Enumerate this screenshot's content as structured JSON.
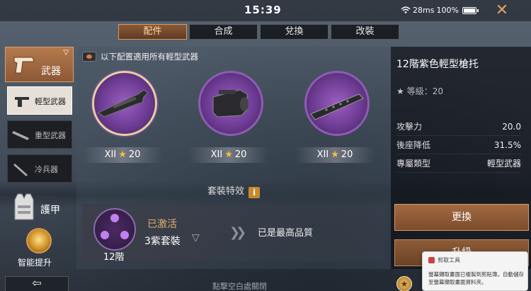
{
  "status_bar": {
    "time": "15:39",
    "latency": "28ms",
    "battery": "100%"
  },
  "tabs": [
    {
      "label": "配件",
      "active": true
    },
    {
      "label": "合成",
      "active": false
    },
    {
      "label": "兌換",
      "active": false
    },
    {
      "label": "改裝",
      "active": false
    }
  ],
  "sidebar": {
    "weapon": "武器",
    "subcategories": [
      {
        "label": "輕型武器",
        "active": true
      },
      {
        "label": "重型武器",
        "active": false
      },
      {
        "label": "冷兵器",
        "active": false
      }
    ],
    "armor": "護甲",
    "boost": "智能提升",
    "back": "⇦"
  },
  "main": {
    "notice": "以下配置適用所有輕型武器",
    "parts": [
      {
        "tier": "XII",
        "stars": "20"
      },
      {
        "tier": "XII",
        "stars": "20"
      },
      {
        "tier": "XII",
        "stars": "20"
      }
    ],
    "set_title": "套裝特效",
    "set": {
      "tier": "12階",
      "status": "已激活",
      "name": "3紫套裝",
      "max_text": "已是最高品質"
    },
    "bottom_hint": "點擊空白處關閉"
  },
  "detail": {
    "title": "12階紫色輕型槍托",
    "grade_label": "等級：20",
    "stats": [
      {
        "label": "攻擊力",
        "value": "20.0"
      },
      {
        "label": "後座降低",
        "value": "31.5%"
      },
      {
        "label": "專屬類型",
        "value": "輕型武器"
      }
    ],
    "replace": "更換",
    "upgrade": "升級"
  },
  "toast": {
    "title": "剪取工具",
    "message": "螢幕擷取畫面已複製到剪貼簿。自動儲存至螢幕擷取畫面資料夾。"
  },
  "colors": {
    "accent": "#b57a4c",
    "purple": "#8d5cb4",
    "gold_star": "#f0c040"
  }
}
